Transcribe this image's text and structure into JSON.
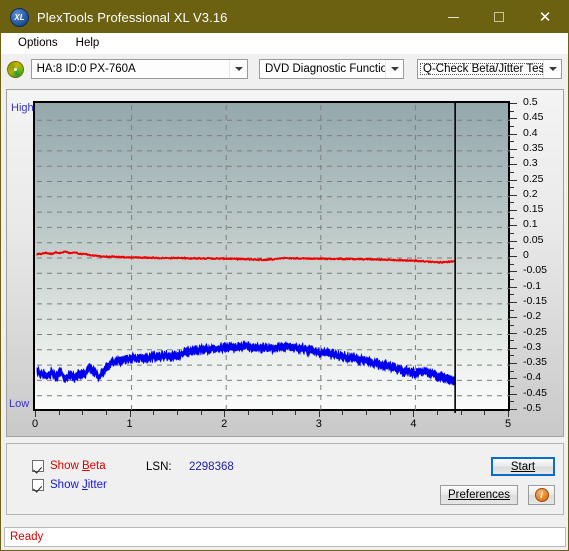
{
  "window": {
    "title": "PlexTools Professional XL V3.16",
    "icon": "XL",
    "minimize": "—",
    "maximize": "□",
    "close": "✕"
  },
  "menu": {
    "items": [
      "Options",
      "Help"
    ]
  },
  "toolbar": {
    "drive": {
      "value": "HA:8 ID:0  PX-760A",
      "icon": "disc-icon"
    },
    "function": {
      "value": "DVD Diagnostic Functions"
    },
    "test": {
      "value": "Q-Check Beta/Jitter Test"
    }
  },
  "controls": {
    "show_beta": {
      "label_pre": "Show ",
      "label_key": "B",
      "label_post": "eta",
      "checked": true,
      "color": "#e00000"
    },
    "show_jitter": {
      "label_pre": "Show ",
      "label_key": "J",
      "label_post": "itter",
      "checked": true,
      "color": "#1515e0"
    },
    "lsn_label": "LSN:",
    "lsn_value": "2298368",
    "start_label": "Start",
    "preferences_label": "Preferences",
    "info_label": "i"
  },
  "status": {
    "text": "Ready"
  },
  "chart_data": {
    "type": "line",
    "title": "Q-Check Beta/Jitter Test",
    "xlabel": "",
    "ylabel": "",
    "xlim": [
      0,
      5
    ],
    "ylim": [
      -0.5,
      0.5
    ],
    "grid": true,
    "legend_position": "bottom-left",
    "y_axis_left_labels": [
      "High",
      "Low"
    ],
    "y_ticks": [
      0.5,
      0.45,
      0.4,
      0.35,
      0.3,
      0.25,
      0.2,
      0.15,
      0.1,
      0.05,
      0,
      -0.05,
      -0.1,
      -0.15,
      -0.2,
      -0.25,
      -0.3,
      -0.35,
      -0.4,
      -0.45,
      -0.5
    ],
    "y_tick_labels": [
      "0.5",
      "0.45",
      "0.4",
      "0.35",
      "0.3",
      "0.25",
      "0.2",
      "0.15",
      "0.1",
      "0.05",
      "0",
      "-0.05",
      "-0.1",
      "-0.15",
      "-0.2",
      "-0.25",
      "-0.3",
      "-0.35",
      "-0.4",
      "-0.45",
      "-0.5"
    ],
    "x_ticks": [
      0,
      1,
      2,
      3,
      4,
      5
    ],
    "x_tick_labels": [
      "0",
      "1",
      "2",
      "3",
      "4",
      "5"
    ],
    "data_end_x": 4.42,
    "series": [
      {
        "name": "Beta",
        "color": "#ee0000",
        "x": [
          0.0,
          0.05,
          0.1,
          0.15,
          0.2,
          0.25,
          0.3,
          0.35,
          0.4,
          0.45,
          0.5,
          0.55,
          0.6,
          0.65,
          0.7,
          0.75,
          0.8,
          0.85,
          0.9,
          0.95,
          1.0,
          1.1,
          1.2,
          1.3,
          1.4,
          1.5,
          1.6,
          1.7,
          1.8,
          1.9,
          2.0,
          2.1,
          2.2,
          2.3,
          2.4,
          2.5,
          2.6,
          2.7,
          2.8,
          2.9,
          3.0,
          3.1,
          3.2,
          3.3,
          3.4,
          3.5,
          3.6,
          3.7,
          3.8,
          3.9,
          4.0,
          4.1,
          4.2,
          4.3,
          4.42
        ],
        "values": [
          0.012,
          0.014,
          0.017,
          0.013,
          0.019,
          0.016,
          0.021,
          0.015,
          0.018,
          0.013,
          0.014,
          0.01,
          0.008,
          0.006,
          0.005,
          0.004,
          0.004,
          0.003,
          0.003,
          0.002,
          0.002,
          0.001,
          0.001,
          0.0,
          0.0,
          0.0,
          -0.001,
          -0.001,
          -0.001,
          -0.002,
          -0.002,
          -0.003,
          -0.004,
          -0.005,
          -0.006,
          -0.004,
          0.0,
          -0.001,
          -0.001,
          -0.002,
          -0.002,
          -0.003,
          -0.003,
          -0.003,
          -0.004,
          -0.004,
          -0.005,
          -0.006,
          -0.007,
          -0.008,
          -0.009,
          -0.011,
          -0.013,
          -0.014,
          -0.01
        ],
        "band": 0.006
      },
      {
        "name": "Jitter",
        "color": "#0000ee",
        "x": [
          0.0,
          0.05,
          0.1,
          0.15,
          0.2,
          0.25,
          0.3,
          0.35,
          0.4,
          0.45,
          0.5,
          0.55,
          0.6,
          0.65,
          0.7,
          0.75,
          0.8,
          0.85,
          0.9,
          0.95,
          1.0,
          1.1,
          1.2,
          1.3,
          1.4,
          1.5,
          1.6,
          1.7,
          1.8,
          1.9,
          2.0,
          2.1,
          2.2,
          2.3,
          2.4,
          2.5,
          2.6,
          2.7,
          2.8,
          2.9,
          3.0,
          3.1,
          3.2,
          3.3,
          3.4,
          3.5,
          3.6,
          3.7,
          3.8,
          3.9,
          4.0,
          4.1,
          4.2,
          4.3,
          4.42
        ],
        "values": [
          -0.37,
          -0.378,
          -0.385,
          -0.375,
          -0.39,
          -0.372,
          -0.395,
          -0.38,
          -0.388,
          -0.376,
          -0.382,
          -0.36,
          -0.368,
          -0.39,
          -0.372,
          -0.355,
          -0.34,
          -0.336,
          -0.332,
          -0.33,
          -0.328,
          -0.326,
          -0.324,
          -0.322,
          -0.32,
          -0.318,
          -0.305,
          -0.3,
          -0.298,
          -0.296,
          -0.294,
          -0.292,
          -0.29,
          -0.292,
          -0.294,
          -0.296,
          -0.292,
          -0.288,
          -0.296,
          -0.304,
          -0.31,
          -0.314,
          -0.32,
          -0.326,
          -0.332,
          -0.338,
          -0.344,
          -0.352,
          -0.362,
          -0.37,
          -0.378,
          -0.372,
          -0.382,
          -0.392,
          -0.398
        ],
        "band": 0.028
      }
    ]
  }
}
